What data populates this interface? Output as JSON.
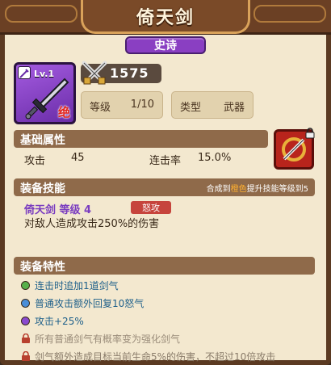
{
  "header": {
    "title": "倚天剑",
    "rarity": "史诗"
  },
  "item": {
    "level_badge": "Lv.1",
    "grade_mark": "绝",
    "power": "1575",
    "level_label": "等级",
    "level_value": "1/10",
    "type_label": "类型",
    "type_value": "武器"
  },
  "base_attrs": {
    "title": "基础属性",
    "attack_label": "攻击",
    "attack_value": "45",
    "crit_label": "连击率",
    "crit_value": "15.0%"
  },
  "skill": {
    "title": "装备技能",
    "note_prefix": "合成到",
    "note_highlight": "橙色",
    "note_suffix": "提升技能等级到5",
    "name": "倚天剑 等级 4",
    "tag": "怒攻",
    "desc": "对敌人造成攻击250%的伤害"
  },
  "traits": {
    "title": "装备特性",
    "items": [
      {
        "text": "连击时追加1道剑气",
        "color": "#58b04a",
        "locked": false
      },
      {
        "text": "普通攻击额外回复10怒气",
        "color": "#4a8ed8",
        "locked": false
      },
      {
        "text": "攻击+25%",
        "color": "#8a4ad0",
        "locked": false
      },
      {
        "text": "所有普通剑气有概率变为强化剑气",
        "color": "#9a8c7a",
        "locked": true
      },
      {
        "text": "剑气额外造成目标当前生命5%的伤害，不超过10倍攻击",
        "color": "#8a7c6a",
        "locked": true
      }
    ]
  },
  "colors": {
    "panel_bg": "#f3e8cf",
    "header_bg": "#6b4024",
    "epic_purple": "#8a3fc2",
    "section_head": "#8f6a4a"
  }
}
